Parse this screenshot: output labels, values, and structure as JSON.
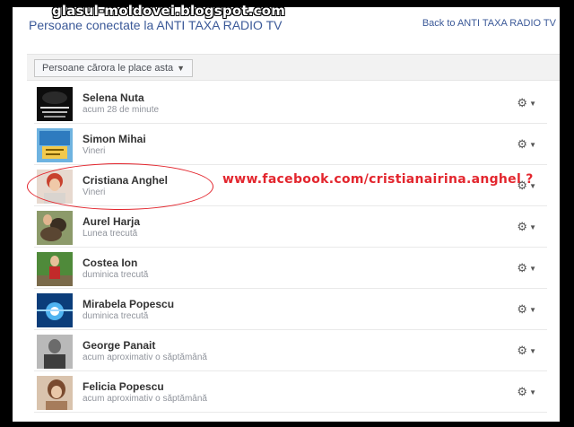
{
  "watermark": "glasul-moldovei.blogspot.com",
  "header": {
    "title": "Persoane conectate la ANTI TAXA RADIO TV",
    "back_link": "Back to ANTI TAXA RADIO TV"
  },
  "toolbar": {
    "filter_label": "Persoane cărora le place asta"
  },
  "people": [
    {
      "name": "Selena Nuta",
      "time": "acum 28 de minute"
    },
    {
      "name": "Simon Mihai",
      "time": "Vineri"
    },
    {
      "name": "Cristiana Anghel",
      "time": "Vineri"
    },
    {
      "name": "Aurel Harja",
      "time": "Lunea trecută"
    },
    {
      "name": "Costea Ion",
      "time": "duminica trecută"
    },
    {
      "name": "Mirabela Popescu",
      "time": "duminica trecută"
    },
    {
      "name": "George Panait",
      "time": "acum aproximativ o săptămână"
    },
    {
      "name": "Felicia Popescu",
      "time": "acum aproximativ o săptămână"
    }
  ],
  "annotation": {
    "text": "www.facebook.com/cristianairina.anghel ?",
    "color": "#e3262e"
  },
  "colors": {
    "link": "#3b5998",
    "muted": "#90949c"
  },
  "icons": {
    "row_action": "gear-icon",
    "dropdown": "chevron-down-icon"
  }
}
